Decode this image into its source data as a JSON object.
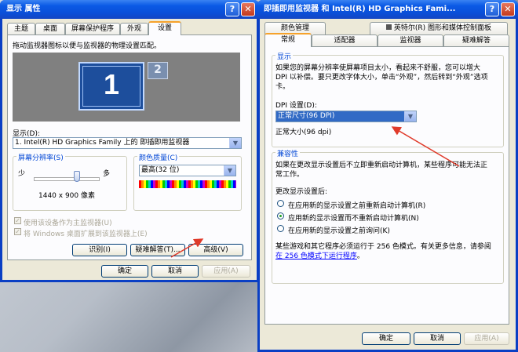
{
  "left_window": {
    "title": "显示 属性",
    "tabs": [
      "主题",
      "桌面",
      "屏幕保护程序",
      "外观",
      "设置"
    ],
    "instruction": "拖动监视器图标以便与监视器的物理设置匹配。",
    "monitor1": "1",
    "monitor2": "2",
    "display_label": "显示(D):",
    "display_value": "1. Intel(R) HD Graphics Family 上的 即插即用监视器",
    "resolution_group": "屏幕分辨率(S)",
    "less_label": "少",
    "more_label": "多",
    "resolution_value": "1440 x 900 像素",
    "color_group": "颜色质量(C)",
    "color_value": "最高(32 位)",
    "chk_primary": "使用该设备作为主监视器(U)",
    "chk_extend": "将 Windows 桌面扩展到该监视器上(E)",
    "btn_identify": "识别(I)",
    "btn_troubleshoot": "疑难解答(T)...",
    "btn_advanced": "高级(V)",
    "btn_ok": "确定",
    "btn_cancel": "取消",
    "btn_apply": "应用(A)"
  },
  "right_window": {
    "title": "即插即用监视器 和 Intel(R) HD Graphics Fami...",
    "tabs_row1": [
      "颜色管理",
      "英特尔(R) 图形和媒体控制面板"
    ],
    "tabs_row2": [
      "常规",
      "适配器",
      "监视器",
      "疑难解答"
    ],
    "display_group": "显示",
    "display_desc": "如果您的屏幕分辨率使屏幕项目太小，看起来不舒服，您可以增大 DPI 以补偿。要只更改字体大小，单击“外观”，然后转到“外观”选项卡。",
    "dpi_label": "DPI 设置(D):",
    "dpi_value": "正常尺寸(96 DPI)",
    "dpi_normal": "正常大小(96 dpi)",
    "compat_group": "兼容性",
    "compat_desc": "如果在更改显示设置后不立即重新启动计算机，某些程序可能无法正常工作。",
    "after_change": "更改显示设置后:",
    "radio1": "在应用新的显示设置之前重新启动计算机(R)",
    "radio2": "应用新的显示设置而不重新启动计算机(N)",
    "radio3": "在应用新的显示设置之前询问(K)",
    "note_prefix": "某些游戏和其它程序必须运行于 256 色模式。有关更多信息，请参阅",
    "note_link": "在 256 色模式下运行程序",
    "note_suffix": "。",
    "btn_ok": "确定",
    "btn_cancel": "取消",
    "btn_apply": "应用(A)"
  },
  "colors": {
    "titlebar": "#0a4fd8",
    "panel": "#fcfcfe",
    "face": "#ece9d8",
    "accent_tab": "#f6a22b",
    "arrow": "#e03a2a",
    "link": "#0000ff"
  }
}
